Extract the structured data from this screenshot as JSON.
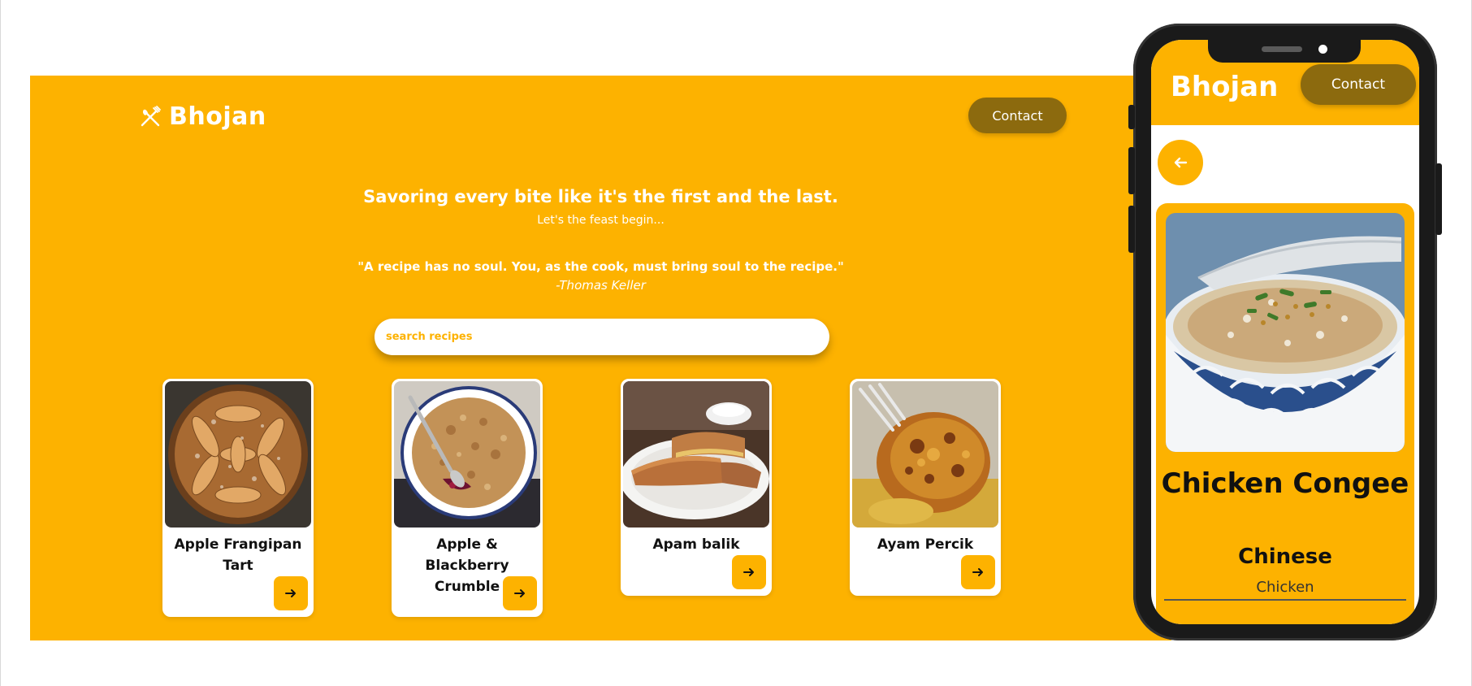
{
  "brand": {
    "name": "Bhojan",
    "logo_icon": "utensils-crossed-icon"
  },
  "header": {
    "contact_label": "Contact"
  },
  "hero": {
    "title": "Savoring every bite like it's the first and the last.",
    "subtitle": "Let's the feast begin...",
    "quote": "\"A recipe has no soul. You, as the cook, must bring soul to the recipe.\"",
    "quote_author": "-Thomas Keller"
  },
  "search": {
    "placeholder": "search recipes"
  },
  "recipes": [
    {
      "name": "Apple Frangipan Tart",
      "image": "apple-tart-photo"
    },
    {
      "name": "Apple & Blackberry Crumble",
      "image": "crumble-photo"
    },
    {
      "name": "Apam balik",
      "image": "pancake-photo"
    },
    {
      "name": "Ayam Percik",
      "image": "grilled-chicken-photo"
    }
  ],
  "phone": {
    "brand": "Bhojan",
    "contact_label": "Contact",
    "back_icon": "arrow-left-icon",
    "meal": {
      "title": "Chicken Congee",
      "area": "Chinese",
      "category": "Chicken",
      "image": "congee-bowl-photo"
    }
  },
  "colors": {
    "accent": "#fdb200",
    "button_dark": "#8c6a0e",
    "text": "#111111",
    "surface": "#ffffff"
  }
}
